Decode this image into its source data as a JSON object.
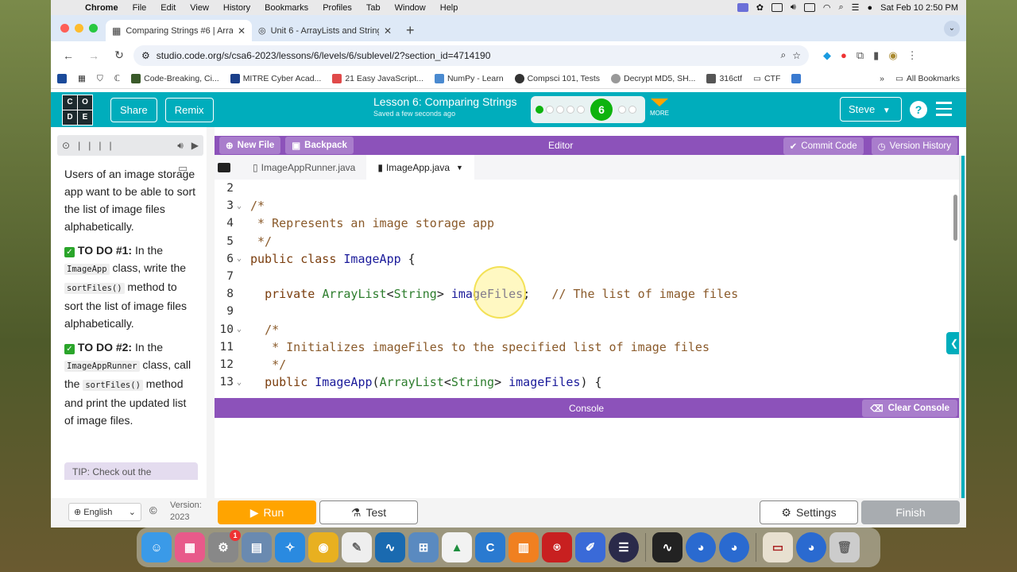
{
  "menubar": {
    "app": "Chrome",
    "items": [
      "File",
      "Edit",
      "View",
      "History",
      "Bookmarks",
      "Profiles",
      "Tab",
      "Window",
      "Help"
    ],
    "datetime": "Sat Feb 10  2:50 PM"
  },
  "browser": {
    "tabs": [
      {
        "title": "Comparing Strings #6 | Array",
        "active": true
      },
      {
        "title": "Unit 6 - ArrayLists and String",
        "active": false
      }
    ],
    "url": "studio.code.org/s/csa6-2023/lessons/6/levels/6/sublevel/2?section_id=4714190",
    "bookmarks": [
      "Code-Breaking, Ci...",
      "MITRE Cyber Acad...",
      "21 Easy JavaScript...",
      "NumPy - Learn",
      "Compsci 101, Tests",
      "Decrypt MD5, SH...",
      "316ctf",
      "CTF"
    ],
    "all_bookmarks": "All Bookmarks"
  },
  "header": {
    "logo_letters": [
      "C",
      "O",
      "D",
      "E"
    ],
    "share": "Share",
    "remix": "Remix",
    "lesson_title": "Lesson 6: Comparing Strings",
    "saved": "Saved a few seconds ago",
    "current_level": "6",
    "more": "MORE",
    "user": "Steve",
    "help": "?"
  },
  "instructions": {
    "intro": "Users of an image storage app want to be able to sort the list of image files alphabetically.",
    "todo1_label": "TO DO #1:",
    "todo1_pre": " In the ",
    "todo1_code1": "ImageApp",
    "todo1_mid": " class, write the ",
    "todo1_code2": "sortFiles()",
    "todo1_post": " method to sort the list of image files alphabetically.",
    "todo2_label": "TO DO #2:",
    "todo2_pre": " In the ",
    "todo2_code1": "ImageAppRunner",
    "todo2_mid": " class, call the ",
    "todo2_code2": "sortFiles()",
    "todo2_post": " method and print the updated list of image files.",
    "tip": "TIP: Check out the"
  },
  "editor": {
    "new_file": "New File",
    "backpack": "Backpack",
    "title": "Editor",
    "commit": "Commit Code",
    "history": "Version History",
    "tabs": [
      "ImageAppRunner.java",
      "ImageApp.java"
    ],
    "lines": [
      {
        "n": "2",
        "fold": "",
        "html": ""
      },
      {
        "n": "3",
        "fold": "v",
        "html": "<span class='cm'>/*</span>"
      },
      {
        "n": "4",
        "fold": "",
        "html": "<span class='cm'> * Represents an image storage app</span>"
      },
      {
        "n": "5",
        "fold": "",
        "html": "<span class='cm'> */</span>"
      },
      {
        "n": "6",
        "fold": "v",
        "html": "<span class='kw'>public class</span> <span class='id'>ImageApp</span> {"
      },
      {
        "n": "7",
        "fold": "",
        "html": ""
      },
      {
        "n": "8",
        "fold": "",
        "html": "  <span class='kw'>private</span> <span class='ty'>ArrayList</span>&lt;<span class='ty'>String</span>&gt; <span class='id'>imageFiles</span>;   <span class='cm'>// The list of image files</span>"
      },
      {
        "n": "9",
        "fold": "",
        "html": ""
      },
      {
        "n": "10",
        "fold": "v",
        "html": "  <span class='cm'>/*</span>"
      },
      {
        "n": "11",
        "fold": "",
        "html": "<span class='cm'>   * Initializes imageFiles to the specified list of image files</span>"
      },
      {
        "n": "12",
        "fold": "",
        "html": "<span class='cm'>   */</span>"
      },
      {
        "n": "13",
        "fold": "v",
        "html": "  <span class='kw'>public</span> <span class='id'>ImageApp</span>(<span class='ty'>ArrayList</span>&lt;<span class='ty'>String</span>&gt; <span class='id'>imageFiles</span>) {"
      }
    ]
  },
  "console": {
    "title": "Console",
    "clear": "Clear Console"
  },
  "footer": {
    "language": "English",
    "version_label": "Version:",
    "version": "2023",
    "run": "Run",
    "test": "Test",
    "settings": "Settings",
    "finish": "Finish"
  },
  "colors": {
    "teal": "#00adbc",
    "purple": "#8c52ba",
    "orange": "#ffa400",
    "green": "#0eb30e"
  }
}
